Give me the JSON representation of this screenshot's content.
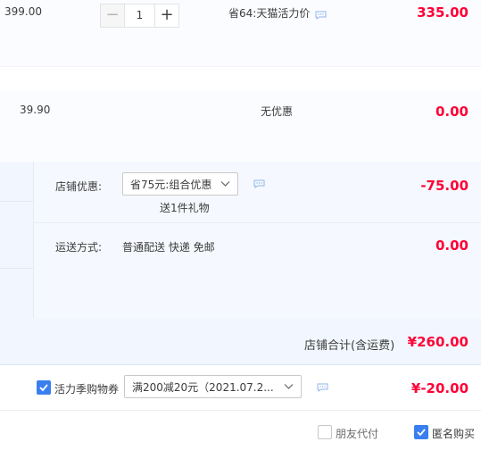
{
  "item1": {
    "unit_price": "399.00",
    "quantity": "1",
    "minus_label": "−",
    "plus_label": "+",
    "promo_text": "省64:天猫活力价",
    "total": "335.00"
  },
  "item2": {
    "unit_price": "39.90",
    "promo_text": "无优惠",
    "total": "0.00"
  },
  "shop": {
    "discount_label": "店铺优惠:",
    "discount_select": "省75元:组合优惠",
    "gift_text": "送1件礼物",
    "discount_amount": "-75.00",
    "shipping_label": "运送方式:",
    "shipping_method": "普通配送 快递 免邮",
    "shipping_amount": "0.00",
    "subtotal_label": "店铺合计(含运费)",
    "subtotal_amount": "¥260.00"
  },
  "coupon": {
    "label": "活力季购物券",
    "select_value": "满200减20元（2021.07.2...",
    "amount": "¥-20.00",
    "checked": true
  },
  "footer": {
    "friend_pay_label": "朋友代付",
    "friend_pay_checked": false,
    "anonymous_label": "匿名购买",
    "anonymous_checked": true
  },
  "colors": {
    "price_red": "#ff0036",
    "checkbox_blue": "#3a7ff0",
    "icon_blue": "#8fb4ea"
  }
}
